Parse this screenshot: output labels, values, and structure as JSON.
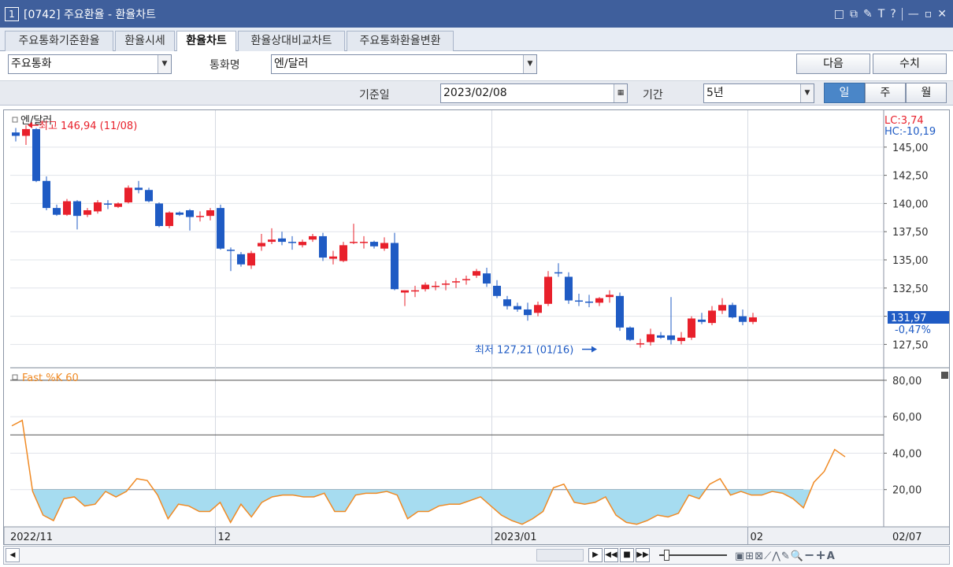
{
  "window": {
    "number": "1",
    "title": "[0742]  주요환율 - 환율차트",
    "icons": [
      "□",
      "⧉",
      "✎",
      "T",
      "?",
      "—",
      "▫",
      "✕"
    ]
  },
  "tabs": [
    {
      "label": "주요통화기준환율",
      "active": false
    },
    {
      "label": "환율시세",
      "active": false
    },
    {
      "label": "환율차트",
      "active": true
    },
    {
      "label": "환율상대비교차트",
      "active": false
    },
    {
      "label": "주요통화환율변환",
      "active": false
    }
  ],
  "controls": {
    "group_value": "주요통화",
    "currency_label": "통화명",
    "currency_value": "엔/달러",
    "next_button": "다음",
    "value_button": "수치",
    "base_date_label": "기준일",
    "base_date_value": "2023/02/08",
    "period_label": "기간",
    "period_value": "5년",
    "periods": [
      "일",
      "주",
      "월"
    ],
    "active_period": "일"
  },
  "icons": {
    "dropdown": "chevron-down-icon",
    "calendar": "calendar-icon",
    "scroll_left": "arrow-left-icon"
  },
  "colors": {
    "up": "#e8202b",
    "down": "#1f5bc4",
    "stoch_line": "#f08a24",
    "stoch_fill": "#a6dcf0",
    "accent": "#4a86c8"
  },
  "chart_data": [
    {
      "type": "candlestick",
      "title": "엔/달러",
      "ylim": [
        125.5,
        148.2
      ],
      "yticks": [
        "145,00",
        "142,50",
        "140,00",
        "137,50",
        "135,00",
        "132,50",
        "130,00",
        "127,50"
      ],
      "ytick_values": [
        145,
        142.5,
        140,
        137.5,
        135,
        132.5,
        130,
        127.5
      ],
      "xticks": [
        {
          "label": "2022/11",
          "index": 0
        },
        {
          "label": "12",
          "index": 20
        },
        {
          "label": "2023/01",
          "index": 47
        },
        {
          "label": "02",
          "index": 72
        },
        {
          "label": "02/07",
          "index": 78
        }
      ],
      "last_value": "131,97",
      "last_change": "-0,47%",
      "lc_text": "LC:3,74",
      "hc_text": "HC:-10,19",
      "high_annotation": "최고 146,94 (11/08)",
      "low_annotation": "최저 127,21 (01/16)",
      "high_point": {
        "index": 1,
        "value": 146.94
      },
      "low_point": {
        "index": 57,
        "value": 127.21
      },
      "candles": [
        [
          146.3,
          146.7,
          145.5,
          146.0
        ],
        [
          146.0,
          146.94,
          145.2,
          146.6
        ],
        [
          146.6,
          146.7,
          141.9,
          142.0
        ],
        [
          142.0,
          142.4,
          139.4,
          139.6
        ],
        [
          139.6,
          139.9,
          138.9,
          139.0
        ],
        [
          139.0,
          140.4,
          138.9,
          140.2
        ],
        [
          140.2,
          140.3,
          137.7,
          138.9
        ],
        [
          139.0,
          139.6,
          138.8,
          139.4
        ],
        [
          139.3,
          140.3,
          139.1,
          140.1
        ],
        [
          140.0,
          140.3,
          139.5,
          139.9
        ],
        [
          139.7,
          140.1,
          139.6,
          140.0
        ],
        [
          140.1,
          141.6,
          140.0,
          141.4
        ],
        [
          141.4,
          142.0,
          140.9,
          141.2
        ],
        [
          141.2,
          141.4,
          140.1,
          140.2
        ],
        [
          140.0,
          140.1,
          137.9,
          138.0
        ],
        [
          138.0,
          139.3,
          137.8,
          139.2
        ],
        [
          139.2,
          139.3,
          138.9,
          139.0
        ],
        [
          139.4,
          139.5,
          137.6,
          138.8
        ],
        [
          138.8,
          139.3,
          138.4,
          138.9
        ],
        [
          138.9,
          139.6,
          138.5,
          139.4
        ],
        [
          139.6,
          139.9,
          135.9,
          136.0
        ],
        [
          135.9,
          136.1,
          134.0,
          135.8
        ],
        [
          135.5,
          135.7,
          134.4,
          134.6
        ],
        [
          134.5,
          135.8,
          134.2,
          135.6
        ],
        [
          136.2,
          137.3,
          135.8,
          136.5
        ],
        [
          136.6,
          137.8,
          136.4,
          136.8
        ],
        [
          136.9,
          137.5,
          136.3,
          136.6
        ],
        [
          136.6,
          137.1,
          135.9,
          136.5
        ],
        [
          136.3,
          136.8,
          136.1,
          136.6
        ],
        [
          136.8,
          137.3,
          136.6,
          137.1
        ],
        [
          137.1,
          137.4,
          134.9,
          135.2
        ],
        [
          135.1,
          135.8,
          134.6,
          135.3
        ],
        [
          134.9,
          136.6,
          134.8,
          136.3
        ],
        [
          136.5,
          138.2,
          136.4,
          136.6
        ],
        [
          136.6,
          137.1,
          136.0,
          136.6
        ],
        [
          136.6,
          136.7,
          136.0,
          136.2
        ],
        [
          136.0,
          137.0,
          135.8,
          136.5
        ],
        [
          136.5,
          137.4,
          132.3,
          132.4
        ],
        [
          132.1,
          132.2,
          130.9,
          132.3
        ],
        [
          132.2,
          132.7,
          131.7,
          132.3
        ],
        [
          132.4,
          133.0,
          132.2,
          132.8
        ],
        [
          132.7,
          133.1,
          132.3,
          132.7
        ],
        [
          132.8,
          133.2,
          132.3,
          132.9
        ],
        [
          133.0,
          133.4,
          132.5,
          133.1
        ],
        [
          133.2,
          133.6,
          132.8,
          133.3
        ],
        [
          133.6,
          134.2,
          133.4,
          134.0
        ],
        [
          133.8,
          134.3,
          132.6,
          132.9
        ],
        [
          132.7,
          133.2,
          131.6,
          131.8
        ],
        [
          131.5,
          131.8,
          130.6,
          130.9
        ],
        [
          130.9,
          131.2,
          130.4,
          130.6
        ],
        [
          130.6,
          131.2,
          129.6,
          130.1
        ],
        [
          130.3,
          131.3,
          130.0,
          131.0
        ],
        [
          131.1,
          134.0,
          130.9,
          133.5
        ],
        [
          133.9,
          134.7,
          133.5,
          133.8
        ],
        [
          133.5,
          133.9,
          131.1,
          131.4
        ],
        [
          131.4,
          132.0,
          130.9,
          131.3
        ],
        [
          131.3,
          131.9,
          130.8,
          131.2
        ],
        [
          131.2,
          131.7,
          130.9,
          131.6
        ],
        [
          131.7,
          132.3,
          131.2,
          131.9
        ],
        [
          131.8,
          132.1,
          128.7,
          129.0
        ],
        [
          129.0,
          129.1,
          127.8,
          127.9
        ],
        [
          127.6,
          128.0,
          127.21,
          127.6
        ],
        [
          127.7,
          128.9,
          127.4,
          128.4
        ],
        [
          128.3,
          128.6,
          128.0,
          128.1
        ],
        [
          128.3,
          131.7,
          127.5,
          127.9
        ],
        [
          127.8,
          128.6,
          127.5,
          128.1
        ],
        [
          128.1,
          130.0,
          127.9,
          129.8
        ],
        [
          129.7,
          130.3,
          129.3,
          129.5
        ],
        [
          129.4,
          130.9,
          129.2,
          130.5
        ],
        [
          130.5,
          131.6,
          130.2,
          131.0
        ],
        [
          131.0,
          131.2,
          129.8,
          129.9
        ],
        [
          130.0,
          130.6,
          129.2,
          129.5
        ],
        [
          129.5,
          130.3,
          129.3,
          129.9
        ]
      ]
    },
    {
      "type": "line",
      "title": "Fast %K 60",
      "ylim": [
        0,
        86
      ],
      "yticks": [
        "80,00",
        "60,00",
        "40,00",
        "20,00"
      ],
      "ytick_values": [
        80,
        60,
        40,
        20
      ],
      "reference_lines": [
        20,
        50,
        80
      ],
      "values": [
        55,
        58,
        19,
        6,
        3,
        15,
        16,
        11,
        12,
        19,
        16,
        19,
        26,
        25,
        17,
        4,
        12,
        11,
        8,
        8,
        13,
        2,
        12,
        5,
        13,
        16,
        17,
        17,
        16,
        16,
        18,
        8,
        8,
        17,
        18,
        18,
        19,
        17,
        4,
        8,
        8,
        11,
        12,
        12,
        14,
        16,
        11,
        6,
        3,
        1,
        4,
        8,
        21,
        23,
        13,
        12,
        13,
        16,
        6,
        2,
        1,
        3,
        6,
        5,
        7,
        17,
        15,
        23,
        26,
        17,
        19,
        17,
        17,
        19,
        18,
        15,
        10,
        24,
        30,
        42,
        38
      ]
    }
  ]
}
